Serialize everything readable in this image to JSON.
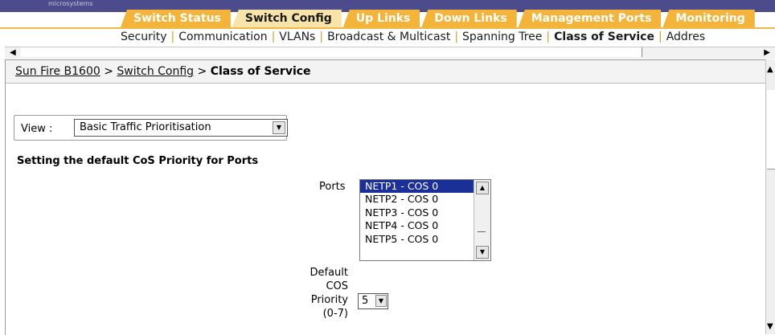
{
  "brand": {
    "text": "microsystems"
  },
  "tabs": [
    {
      "label": "Switch Status",
      "active": false
    },
    {
      "label": "Switch Config",
      "active": true
    },
    {
      "label": "Up Links",
      "active": false
    },
    {
      "label": "Down Links",
      "active": false
    },
    {
      "label": "Management Ports",
      "active": false
    },
    {
      "label": "Monitoring",
      "active": false
    }
  ],
  "subnav": {
    "items": [
      "Security",
      "Communication",
      "VLANs",
      "Broadcast & Multicast",
      "Spanning Tree",
      "Class of Service",
      "Addres"
    ],
    "current": "Class of Service",
    "separator": "|"
  },
  "breadcrumb": {
    "root": "Sun Fire B1600",
    "sep1": ">",
    "parent": "Switch Config",
    "sep2": ">",
    "current": "Class of Service"
  },
  "view": {
    "label": "View :",
    "selected": "Basic Traffic Prioritisation"
  },
  "section_title": "Setting the default CoS Priority for Ports",
  "ports": {
    "label": "Ports",
    "items": [
      "NETP1 - COS 0",
      "NETP2 - COS 0",
      "NETP3 - COS 0",
      "NETP4 - COS 0",
      "NETP5 - COS 0"
    ],
    "selected_index": 0
  },
  "cos_priority": {
    "label": "Default\nCOS\nPriority\n(0-7)",
    "value": "5"
  },
  "icons": {
    "scroll_left": "arrow-left-icon",
    "scroll_right": "arrow-right-icon",
    "scroll_up": "arrow-up-icon",
    "scroll_down": "arrow-down-icon",
    "dropdown": "chevron-down-icon"
  },
  "colors": {
    "tab": "#f4b43a",
    "tab_active": "#f8e3a9",
    "brand_bar": "#4c4c8c",
    "selection": "#1b2f99"
  }
}
